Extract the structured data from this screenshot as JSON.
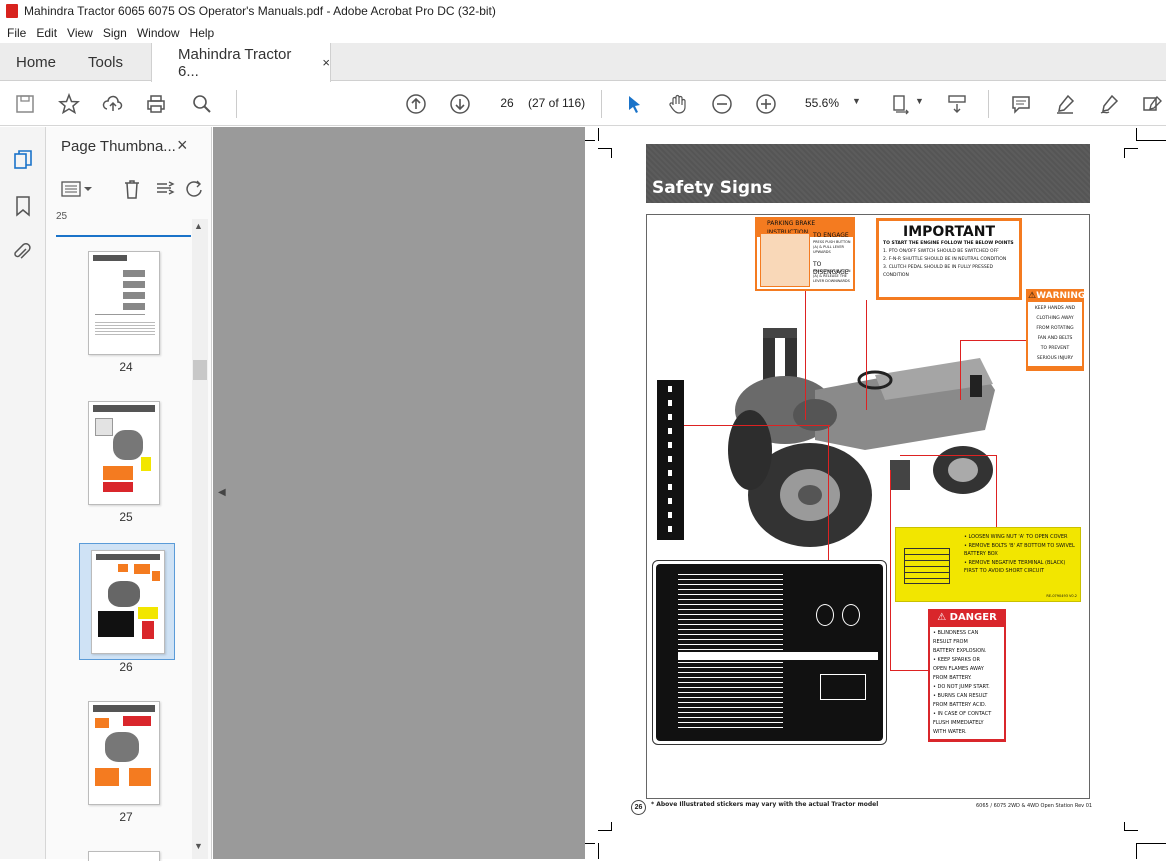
{
  "window": {
    "title": "Mahindra Tractor 6065 6075 OS Operator's Manuals.pdf - Adobe Acrobat Pro DC (32-bit)"
  },
  "menu": [
    "File",
    "Edit",
    "View",
    "Sign",
    "Window",
    "Help"
  ],
  "tabs": {
    "home": "Home",
    "tools": "Tools",
    "doc": "Mahindra Tractor 6...",
    "close": "×"
  },
  "toolbar": {
    "page_value": "26",
    "page_count": "(27 of 116)",
    "zoom": "55.6%"
  },
  "panel": {
    "title": "Page Thumbna...",
    "close": "×"
  },
  "thumbnails": [
    {
      "label": "24"
    },
    {
      "label": "25"
    },
    {
      "label": "26"
    },
    {
      "label": "27"
    }
  ],
  "doc": {
    "section_title": "Safety Signs",
    "parking": {
      "title": "PARKING BRAKE INSTRUCTION",
      "engage": "TO ENGAGE",
      "engage_text": "PRESS PUSH BUTTON (A) & PULL LEVER UPWARDS",
      "disengage": "TO DISENGAGE",
      "disengage_text": "PRESS PUSH BUTTON (A) & RELEASE THE LEVER DOWNWARDS"
    },
    "important": {
      "title": "IMPORTANT",
      "intro": "TO START THE ENGINE FOLLOW THE BELOW POINTS",
      "points": [
        "1. PTO ON/OFF SWITCH SHOULD BE SWITCHED OFF",
        "2. F-N-R SHUTTLE SHOULD BE IN NEUTRAL CONDITION",
        "3. CLUTCH PEDAL SHOULD BE IN FULLY PRESSED CONDITION"
      ]
    },
    "warning": {
      "title": "WARNING",
      "text": [
        "KEEP HANDS AND",
        "CLOTHING AWAY",
        "FROM ROTATING",
        "FAN AND BELTS",
        "TO PREVENT",
        "SERIOUS INJURY"
      ]
    },
    "battery": {
      "text": [
        "• LOOSEN WING NUT 'A' TO OPEN COVER",
        "• REMOVE BOLTS 'B' AT BOTTOM TO SWIVEL BATTERY BOX",
        "• REMOVE NEGATIVE TERMINAL (BLACK) FIRST TO AVOID SHORT CIRCUIT"
      ],
      "code": "RE-0790493 V0.2"
    },
    "danger": {
      "title": "DANGER",
      "text": [
        "• BLINDNESS CAN",
        "RESULT FROM",
        "BATTERY EXPLOSION.",
        "• KEEP SPARKS OR",
        "OPEN FLAMES AWAY",
        "FROM BATTERY.",
        "• DO NOT JUMP START.",
        "• BURNS CAN RESULT",
        "FROM BATTERY ACID.",
        "• IN CASE OF CONTACT",
        "FLUSH IMMEDIATELY",
        "WITH WATER."
      ]
    },
    "page_number": "26",
    "footnote": "* Above Illustrated stickers may vary with the actual Tractor model",
    "footer_right": "6065 / 6075 2WD & 4WD Open Station Rev 01"
  },
  "colors": {
    "orange": "#f47b20",
    "yellow": "#f2e600",
    "red": "#d9262b",
    "accent": "#1a73c9"
  }
}
